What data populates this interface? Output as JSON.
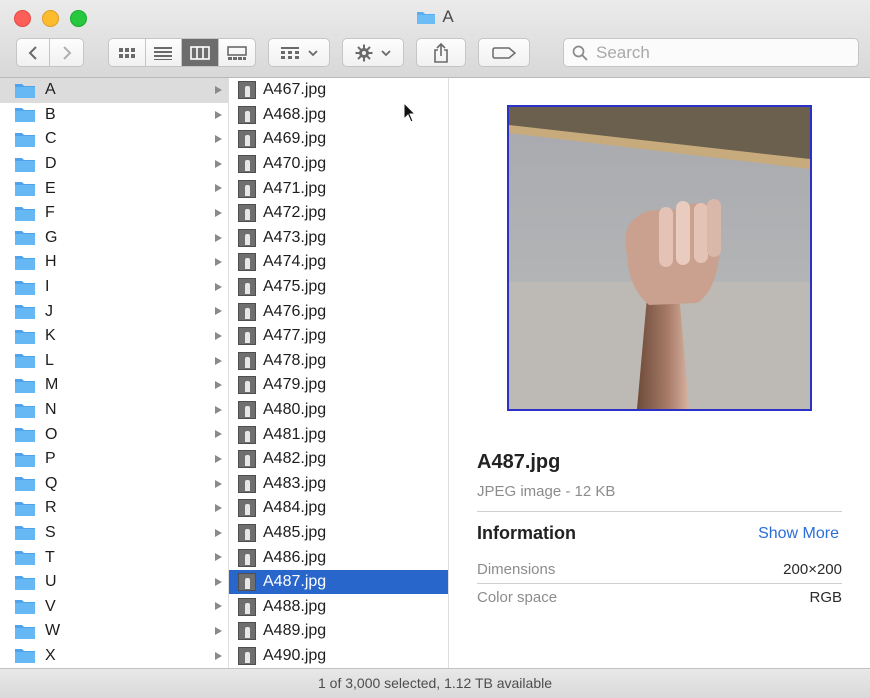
{
  "window": {
    "title": "A"
  },
  "toolbar": {
    "search_placeholder": "Search"
  },
  "folders": [
    "A",
    "B",
    "C",
    "D",
    "E",
    "F",
    "G",
    "H",
    "I",
    "J",
    "K",
    "L",
    "M",
    "N",
    "O",
    "P",
    "Q",
    "R",
    "S",
    "T",
    "U",
    "V",
    "W",
    "X"
  ],
  "files": [
    "A467.jpg",
    "A468.jpg",
    "A469.jpg",
    "A470.jpg",
    "A471.jpg",
    "A472.jpg",
    "A473.jpg",
    "A474.jpg",
    "A475.jpg",
    "A476.jpg",
    "A477.jpg",
    "A478.jpg",
    "A479.jpg",
    "A480.jpg",
    "A481.jpg",
    "A482.jpg",
    "A483.jpg",
    "A484.jpg",
    "A485.jpg",
    "A486.jpg",
    "A487.jpg",
    "A488.jpg",
    "A489.jpg",
    "A490.jpg"
  ],
  "selected_file_index": 20,
  "selected_folder_index": 0,
  "preview": {
    "filename": "A487.jpg",
    "kind": "JPEG image - 12 KB",
    "info_header": "Information",
    "show_more": "Show More",
    "dimensions_label": "Dimensions",
    "dimensions_value": "200×200",
    "colorspace_label": "Color space",
    "colorspace_value": "RGB"
  },
  "status": {
    "text": "1 of 3,000 selected, 1.12 TB available"
  },
  "colors": {
    "selection": "#2966cc",
    "folder": "#5aaef0",
    "link": "#2a6ed8"
  }
}
